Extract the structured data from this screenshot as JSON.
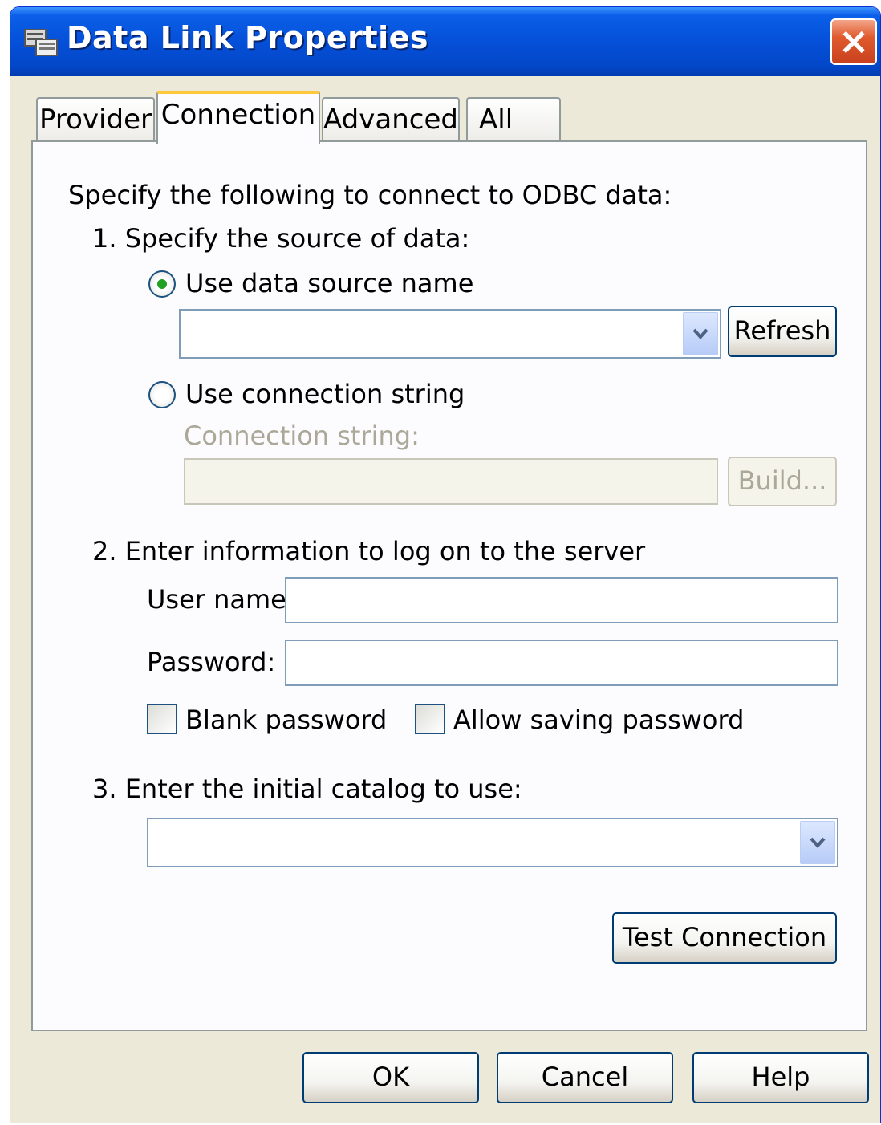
{
  "window": {
    "title": "Data Link Properties",
    "close_glyph": "×",
    "icon": "data-link-icon",
    "accent_color": "#0550d8"
  },
  "tabs": [
    {
      "label": "Provider",
      "active": false
    },
    {
      "label": "Connection",
      "active": true
    },
    {
      "label": "Advanced",
      "active": false
    },
    {
      "label": "All",
      "active": false
    }
  ],
  "connection": {
    "intro": "Specify the following to connect to ODBC data:",
    "step1": {
      "heading": "1. Specify the source of data:",
      "option_dsn": {
        "label": "Use data source name",
        "selected": true
      },
      "dsn_value": "",
      "refresh_label": "Refresh",
      "option_connstr": {
        "label": "Use connection string",
        "selected": false
      },
      "connstr_label": "Connection string:",
      "connstr_value": "",
      "build_label": "Build..."
    },
    "step2": {
      "heading": "2. Enter information to log on to the server",
      "username_label": "User name:",
      "username_value": "",
      "password_label": "Password:",
      "password_value": "",
      "blank_password": {
        "label": "Blank password",
        "checked": false
      },
      "allow_saving": {
        "label": "Allow saving password",
        "checked": false
      }
    },
    "step3": {
      "heading": "3. Enter the initial catalog to use:",
      "catalog_value": ""
    },
    "test_connection_label": "Test Connection"
  },
  "footer": {
    "ok_label": "OK",
    "cancel_label": "Cancel",
    "help_label": "Help"
  }
}
